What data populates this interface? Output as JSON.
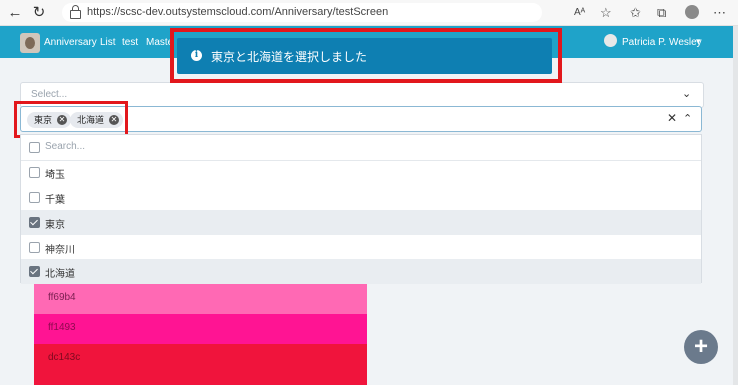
{
  "browser": {
    "url": "https://scsc-dev.outsystemscloud.com/Anniversary/testScreen",
    "icons": [
      "back-icon",
      "refresh-icon",
      "lock-icon",
      "read-aloud-icon",
      "favorite-icon",
      "collections-icon",
      "tabs-icon",
      "profile-icon",
      "more-icon"
    ]
  },
  "header": {
    "app_name": "Anniversary",
    "menu": [
      "List",
      "test",
      "Maste"
    ],
    "user_name": "Patricia P. Wesley",
    "background": "#1fa3c9"
  },
  "toast": {
    "message": "東京と北海道を選択しました",
    "background": "#0e7fb2",
    "highlight_color": "#e2171c"
  },
  "select1": {
    "placeholder": "Select..."
  },
  "select2": {
    "chips": [
      "東京",
      "北海道"
    ]
  },
  "dropdown": {
    "search_placeholder": "Search...",
    "options": [
      {
        "label": "埼玉",
        "checked": false
      },
      {
        "label": "千葉",
        "checked": false
      },
      {
        "label": "東京",
        "checked": true
      },
      {
        "label": "神奈川",
        "checked": false
      },
      {
        "label": "北海道",
        "checked": true
      }
    ]
  },
  "swatches": [
    {
      "label": "ff69b4",
      "color": "#ff69b4"
    },
    {
      "label": "ff1493",
      "color": "#ff1493"
    },
    {
      "label": "dc143c",
      "color": "#dc143c"
    }
  ],
  "fab": {
    "label": "+"
  }
}
